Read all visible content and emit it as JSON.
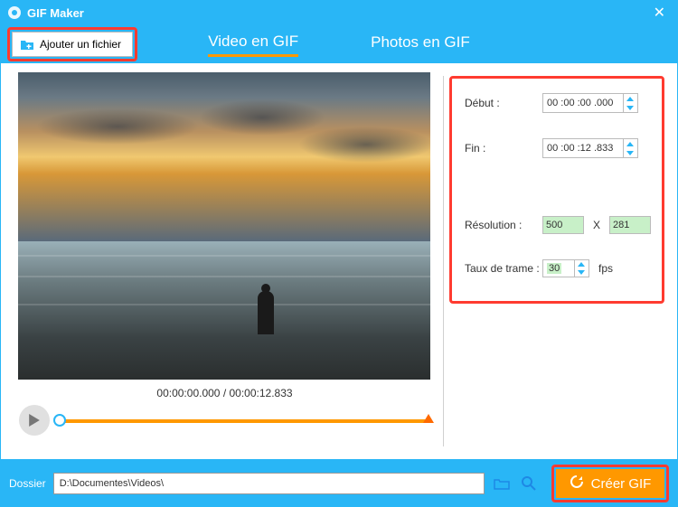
{
  "window": {
    "title": "GIF Maker"
  },
  "toolbar": {
    "add_file": "Ajouter un fichier"
  },
  "tabs": {
    "video": "Video en GIF",
    "photos": "Photos en GIF"
  },
  "preview": {
    "time_current": "00:00:00.000",
    "time_total": "00:00:12.833"
  },
  "settings": {
    "start_label": "Début :",
    "start_value": "00 :00 :00 .000",
    "end_label": "Fin :",
    "end_value": "00 :00 :12 .833",
    "resolution_label": "Résolution :",
    "width": "500",
    "x": "X",
    "height": "281",
    "framerate_label": "Taux de trame :",
    "fps": "30",
    "fps_unit": "fps"
  },
  "footer": {
    "folder_label": "Dossier",
    "path": "D:\\Documentes\\Videos\\",
    "create": "Créer GIF"
  }
}
